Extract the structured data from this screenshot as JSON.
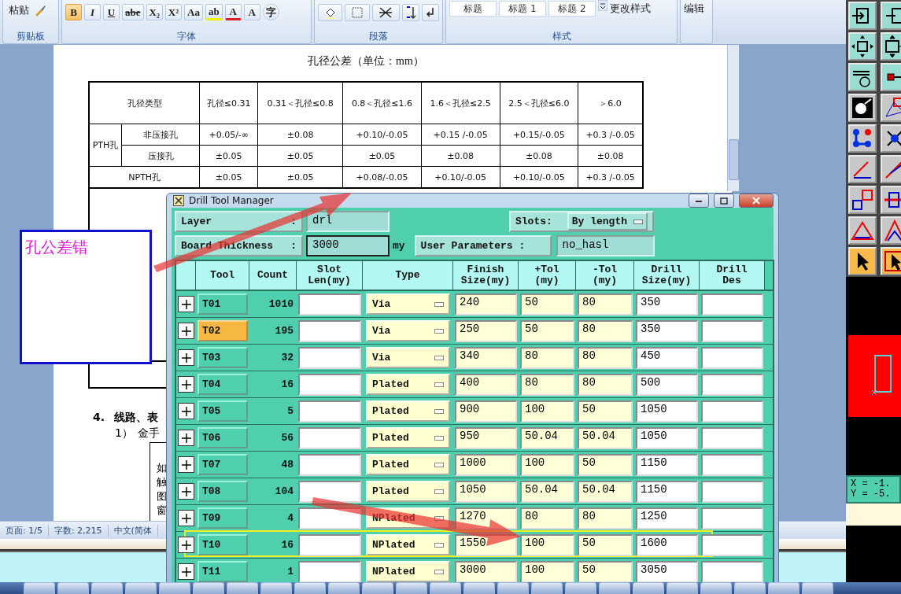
{
  "word": {
    "ribbon": {
      "clipboard": {
        "paste": "粘贴",
        "label": "剪贴板"
      },
      "font": {
        "label": "字体",
        "buttons": [
          {
            "label": "B",
            "active": true
          },
          {
            "label": "I",
            "active": false
          },
          {
            "label": "U",
            "active": false
          },
          {
            "label": "abe",
            "active": false
          },
          {
            "label": "X₂",
            "active": false
          },
          {
            "label": "X²",
            "active": false
          },
          {
            "label": "Aa",
            "active": false
          },
          {
            "label": "ab",
            "active": false
          },
          {
            "label": "A",
            "active": false
          },
          {
            "label": "A",
            "active": false
          },
          {
            "label": "字",
            "active": false
          }
        ]
      },
      "paragraph": {
        "label": "段落"
      },
      "styles": {
        "label": "样式",
        "items": [
          "标题",
          "标题 1",
          "标题 2"
        ],
        "change": "更改样式"
      },
      "editing": {
        "label": "编辑"
      }
    },
    "document": {
      "title": "孔径公差（单位：mm）",
      "table": {
        "type_header": "孔径类型",
        "columns": [
          "孔径≤0.31",
          "0.31＜孔径≤0.8",
          "0.8＜孔径≤1.6",
          "1.6＜孔径≤2.5",
          "2.5＜孔径≤6.0",
          "＞6.0"
        ],
        "rows": [
          {
            "kind": "group",
            "label": "PTH孔",
            "children": [
              {
                "name": "非压接孔",
                "values": [
                  "+0.05/-∞",
                  "±0.08",
                  "+0.10/-0.05",
                  "+0.15 /-0.05",
                  "+0.15/-0.05",
                  "+0.3 /-0.05"
                ]
              },
              {
                "name": "压接孔",
                "values": [
                  "±0.05",
                  "±0.05",
                  "±0.05",
                  "±0.08",
                  "±0.08",
                  "±0.08"
                ]
              }
            ]
          },
          {
            "kind": "single",
            "label": "NPTH孔",
            "values": [
              "±0.05",
              "±0.05",
              "+0.08/-0.05",
              "+0.10/-0.05",
              "+0.10/-0.05",
              "+0.3 /-0.05"
            ]
          }
        ]
      },
      "section_number": "4.",
      "section_title": "线路、表",
      "item_number": "1）",
      "item_text": "金手",
      "side_column": [
        "如",
        "触",
        "图",
        "窗"
      ]
    },
    "status_bar": [
      "页面: 1/5",
      "字数: 2,215",
      "中文(简体"
    ]
  },
  "annotation": {
    "text": "孔公差错"
  },
  "dialog": {
    "title": "Drill Tool Manager",
    "layer": {
      "label": "Layer",
      "colon": ":",
      "value": "drl"
    },
    "slots": {
      "label": "Slots:",
      "value": "By length"
    },
    "board_thickness": {
      "label": "Board Thickness",
      "colon": ":",
      "value": "3000",
      "unit": "my"
    },
    "user_parameters": {
      "label": "User Parameters :",
      "value": "no_hasl"
    },
    "columns": [
      "Tool",
      "Count",
      "Slot Len(my)",
      "Type",
      "Finish Size(my)",
      "+Tol (my)",
      "-Tol (my)",
      "Drill Size(my)",
      "Drill Des"
    ],
    "rows": [
      {
        "tool": "T01",
        "count": "1010",
        "type": "Via",
        "finish": "240",
        "plus_tol": "50",
        "minus_tol": "80",
        "drill": "350",
        "selected": false,
        "highlighted": false
      },
      {
        "tool": "T02",
        "count": "195",
        "type": "Via",
        "finish": "250",
        "plus_tol": "50",
        "minus_tol": "80",
        "drill": "350",
        "selected": true,
        "highlighted": false
      },
      {
        "tool": "T03",
        "count": "32",
        "type": "Via",
        "finish": "340",
        "plus_tol": "80",
        "minus_tol": "80",
        "drill": "450",
        "selected": false,
        "highlighted": false
      },
      {
        "tool": "T04",
        "count": "16",
        "type": "Plated",
        "finish": "400",
        "plus_tol": "80",
        "minus_tol": "80",
        "drill": "500",
        "selected": false,
        "highlighted": false
      },
      {
        "tool": "T05",
        "count": "5",
        "type": "Plated",
        "finish": "900",
        "plus_tol": "100",
        "minus_tol": "50",
        "drill": "1050",
        "selected": false,
        "highlighted": false
      },
      {
        "tool": "T06",
        "count": "56",
        "type": "Plated",
        "finish": "950",
        "plus_tol": "50.04",
        "minus_tol": "50.04",
        "drill": "1050",
        "selected": false,
        "highlighted": false
      },
      {
        "tool": "T07",
        "count": "48",
        "type": "Plated",
        "finish": "1000",
        "plus_tol": "100",
        "minus_tol": "50",
        "drill": "1150",
        "selected": false,
        "highlighted": false
      },
      {
        "tool": "T08",
        "count": "104",
        "type": "Plated",
        "finish": "1050",
        "plus_tol": "50.04",
        "minus_tol": "50.04",
        "drill": "1150",
        "selected": false,
        "highlighted": false
      },
      {
        "tool": "T09",
        "count": "4",
        "type": "NPlated",
        "finish": "1270",
        "plus_tol": "80",
        "minus_tol": "80",
        "drill": "1250",
        "selected": false,
        "highlighted": false
      },
      {
        "tool": "T10",
        "count": "16",
        "type": "NPlated",
        "finish": "1550",
        "plus_tol": "100",
        "minus_tol": "50",
        "drill": "1600",
        "selected": false,
        "highlighted": true
      },
      {
        "tool": "T11",
        "count": "1",
        "type": "NPlated",
        "finish": "3000",
        "plus_tol": "100",
        "minus_tol": "50",
        "drill": "3050",
        "selected": false,
        "highlighted": false
      }
    ]
  },
  "cam_panel": {
    "coords": [
      "X = -1.",
      "Y = -5."
    ]
  }
}
